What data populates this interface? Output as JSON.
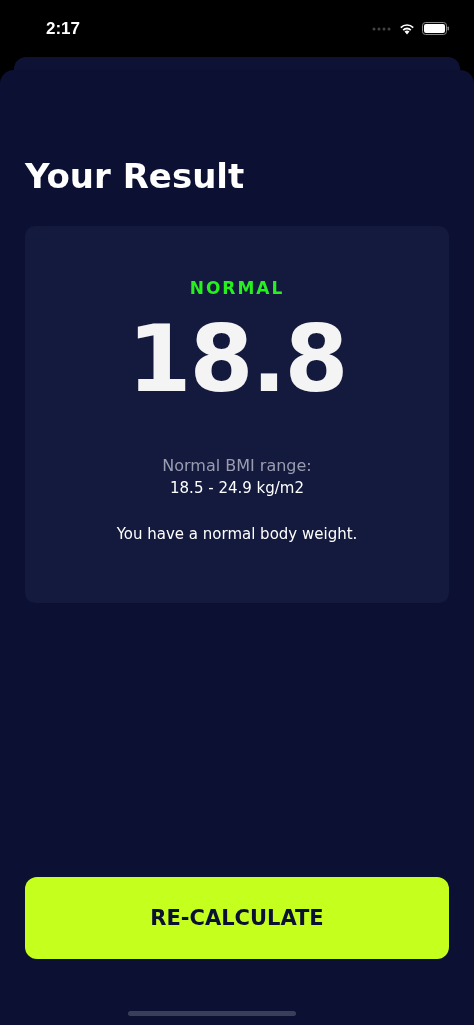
{
  "status_bar": {
    "time": "2:17"
  },
  "title": "Your Result",
  "result": {
    "category": "NORMAL",
    "bmi": "18.8",
    "range_label": "Normal BMI range:",
    "range_value": "18.5 - 24.9 kg/m2",
    "message": "You have a normal body weight."
  },
  "button": {
    "label": "RE-CALCULATE"
  }
}
